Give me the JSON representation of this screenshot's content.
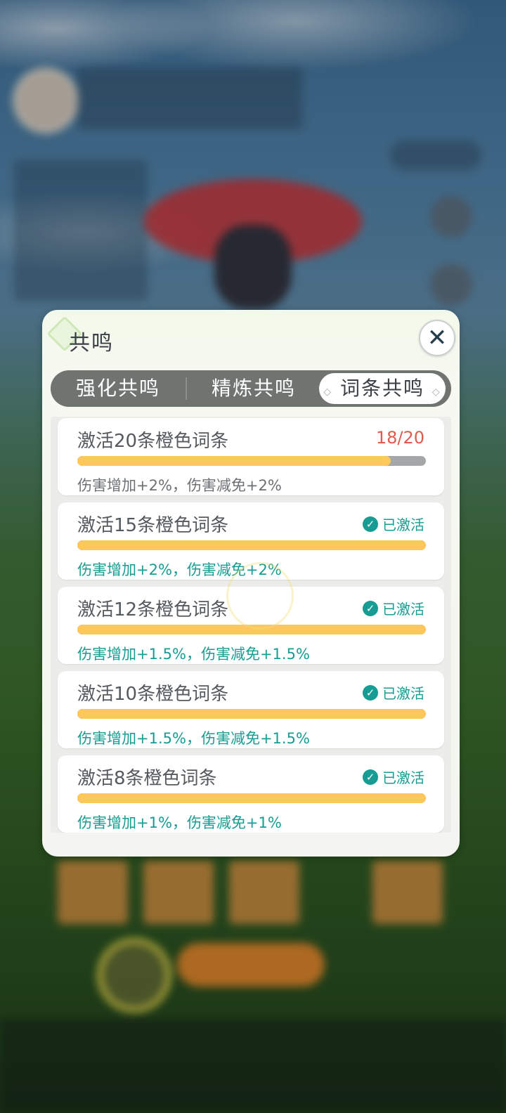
{
  "modal": {
    "title": "共鸣",
    "close_icon": "close-icon",
    "tabs": [
      {
        "label": "强化共鸣",
        "active": false
      },
      {
        "label": "精炼共鸣",
        "active": false
      },
      {
        "label": "词条共鸣",
        "active": true
      }
    ]
  },
  "resonance": {
    "items": [
      {
        "title": "激活20条橙色词条",
        "progress_text": "18/20",
        "progress": 0.9,
        "activated": false,
        "desc": "伤害增加+2%，伤害减免+2%"
      },
      {
        "title": "激活15条橙色词条",
        "status": "已激活",
        "progress": 1.0,
        "activated": true,
        "desc": "伤害增加+2%，伤害减免+2%"
      },
      {
        "title": "激活12条橙色词条",
        "status": "已激活",
        "progress": 1.0,
        "activated": true,
        "desc": "伤害增加+1.5%，伤害减免+1.5%"
      },
      {
        "title": "激活10条橙色词条",
        "status": "已激活",
        "progress": 1.0,
        "activated": true,
        "desc": "伤害增加+1.5%，伤害减免+1.5%"
      },
      {
        "title": "激活8条橙色词条",
        "status": "已激活",
        "progress": 1.0,
        "activated": true,
        "desc": "伤害增加+1%，伤害减免+1%"
      }
    ]
  },
  "colors": {
    "accent_teal": "#169c92",
    "progress_red": "#e15a4b",
    "bar_fill": "#ffc85a"
  }
}
